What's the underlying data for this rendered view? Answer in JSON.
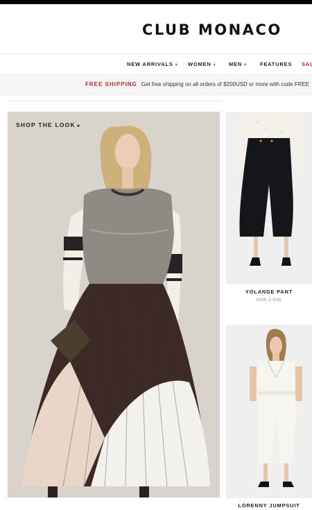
{
  "brand": {
    "logo_text": "CLUB MONACO"
  },
  "nav": {
    "items": [
      {
        "label": "NEW ARRIVALS",
        "chevron": "▾"
      },
      {
        "label": "WOMEN",
        "chevron": "▾"
      },
      {
        "label": "MEN",
        "chevron": "▾"
      },
      {
        "label": "FEATURES",
        "chevron": ""
      },
      {
        "label": "SAL",
        "chevron": ""
      }
    ]
  },
  "promo": {
    "label": "FREE SHIPPING",
    "text": "Get free shipping on all orders of $200USD or more with code FREE"
  },
  "hero": {
    "cta": "SHOP THE LOOK",
    "cta_icon": "▸"
  },
  "products": [
    {
      "name": "YOLANDE PANT",
      "price": "DKK 2,048"
    },
    {
      "name": "LORENNY JUMPSUIT",
      "price": ""
    }
  ],
  "colors": {
    "sale": "#c0272d",
    "promo_label": "#c0272d"
  }
}
